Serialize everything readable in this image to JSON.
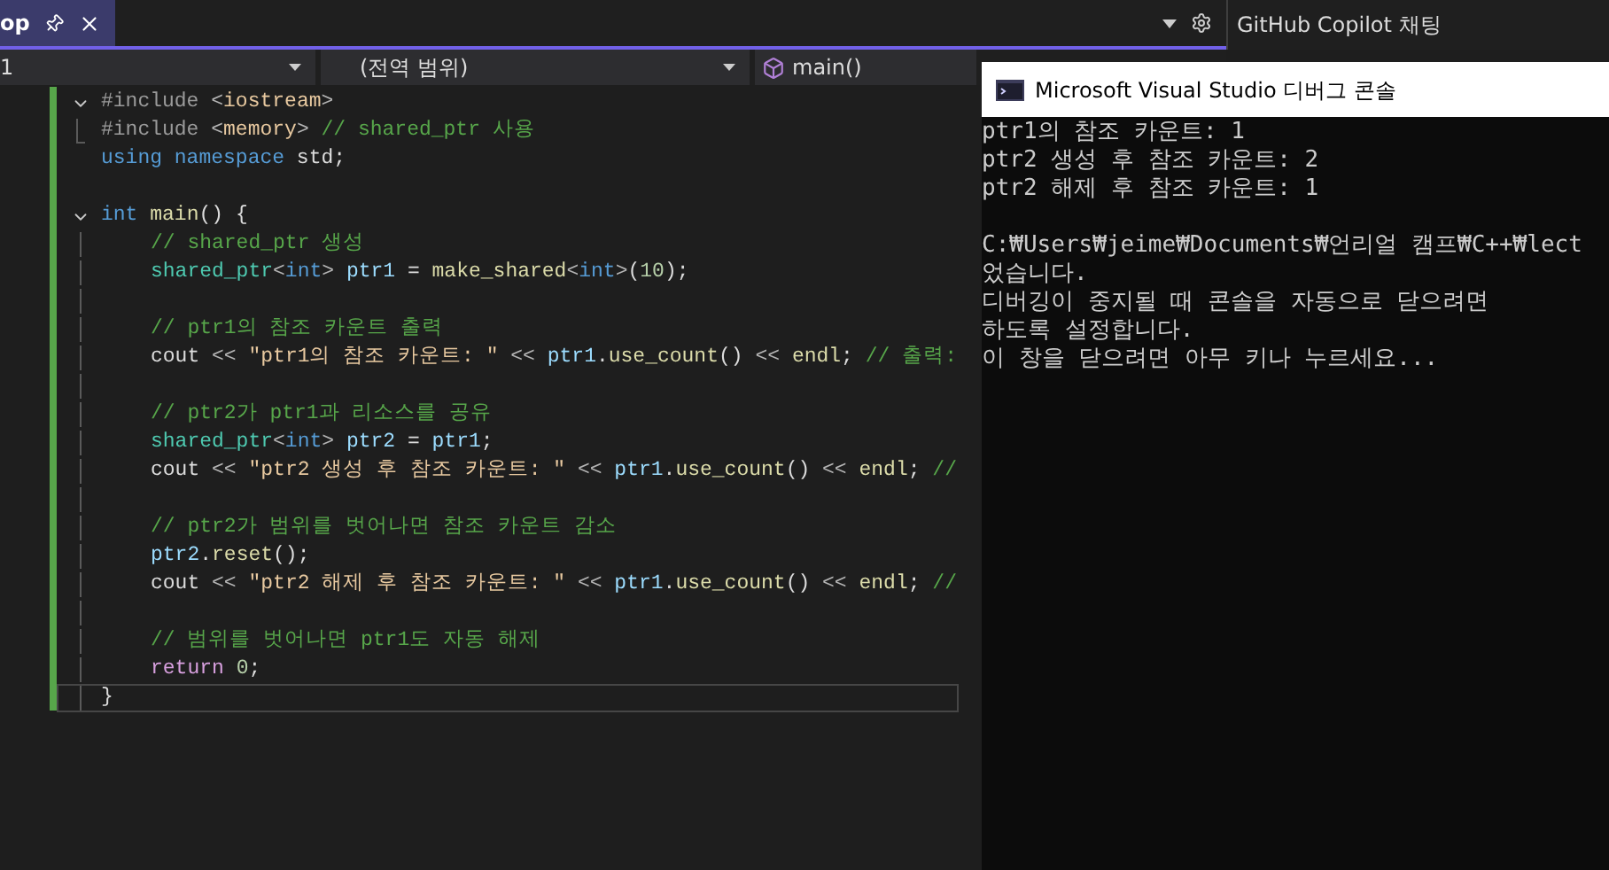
{
  "editor_tab": {
    "label": "op",
    "selected": true
  },
  "nav_bar": {
    "project": "1",
    "scope": "(전역 범위)",
    "member": "main()"
  },
  "copilot_panel": {
    "title": "GitHub Copilot 채팅"
  },
  "code_lines": [
    {
      "kind": "fold_start",
      "segments": [
        {
          "kind": "preproc",
          "text": "#include "
        },
        {
          "kind": "punct",
          "text": "<"
        },
        {
          "kind": "string",
          "text": "iostream"
        },
        {
          "kind": "punct",
          "text": ">"
        }
      ]
    },
    {
      "kind": "fold_end",
      "segments": [
        {
          "kind": "preproc",
          "text": "#include "
        },
        {
          "kind": "punct",
          "text": "<"
        },
        {
          "kind": "string",
          "text": "memory"
        },
        {
          "kind": "punct",
          "text": ">"
        },
        {
          "kind": "comment",
          "text": " // shared_ptr 사용"
        }
      ]
    },
    {
      "kind": "plain",
      "segments": [
        {
          "kind": "keyword",
          "text": "using namespace"
        },
        {
          "kind": "plain",
          "text": " std;"
        }
      ]
    },
    {
      "kind": "plain"
    },
    {
      "kind": "fold_start",
      "segments": [
        {
          "kind": "keyword",
          "text": "int"
        },
        {
          "kind": "func",
          "text": " main"
        },
        {
          "kind": "plain",
          "text": "() {"
        }
      ]
    },
    {
      "kind": "body",
      "segments": [
        {
          "kind": "comment",
          "text": "// shared_ptr 생성"
        }
      ]
    },
    {
      "kind": "body",
      "segments": [
        {
          "kind": "type",
          "text": "shared_ptr"
        },
        {
          "kind": "punct",
          "text": "<"
        },
        {
          "kind": "keyword",
          "text": "int"
        },
        {
          "kind": "punct",
          "text": ">"
        },
        {
          "kind": "var",
          "text": " ptr1"
        },
        {
          "kind": "plain",
          "text": " = "
        },
        {
          "kind": "func",
          "text": "make_shared"
        },
        {
          "kind": "punct",
          "text": "<"
        },
        {
          "kind": "keyword",
          "text": "int"
        },
        {
          "kind": "punct",
          "text": ">"
        },
        {
          "kind": "plain",
          "text": "("
        },
        {
          "kind": "number",
          "text": "10"
        },
        {
          "kind": "plain",
          "text": ");"
        }
      ]
    },
    {
      "kind": "body"
    },
    {
      "kind": "body",
      "segments": [
        {
          "kind": "comment",
          "text": "// ptr1의 참조 카운트 출력"
        }
      ]
    },
    {
      "kind": "body",
      "segments": [
        {
          "kind": "plain",
          "text": "cout "
        },
        {
          "kind": "punct",
          "text": "<< "
        },
        {
          "kind": "string",
          "text": "\"ptr1의 참조 카운트: \""
        },
        {
          "kind": "punct",
          "text": " << "
        },
        {
          "kind": "var",
          "text": "ptr1"
        },
        {
          "kind": "plain",
          "text": "."
        },
        {
          "kind": "func",
          "text": "use_count"
        },
        {
          "kind": "plain",
          "text": "() "
        },
        {
          "kind": "punct",
          "text": "<< "
        },
        {
          "kind": "func",
          "text": "endl"
        },
        {
          "kind": "plain",
          "text": "; "
        },
        {
          "kind": "comment",
          "text": "// 출력:"
        }
      ]
    },
    {
      "kind": "body"
    },
    {
      "kind": "body",
      "segments": [
        {
          "kind": "comment",
          "text": "// ptr2가 ptr1과 리소스를 공유"
        }
      ]
    },
    {
      "kind": "body",
      "segments": [
        {
          "kind": "type",
          "text": "shared_ptr"
        },
        {
          "kind": "punct",
          "text": "<"
        },
        {
          "kind": "keyword",
          "text": "int"
        },
        {
          "kind": "punct",
          "text": ">"
        },
        {
          "kind": "var",
          "text": " ptr2"
        },
        {
          "kind": "plain",
          "text": " = "
        },
        {
          "kind": "var",
          "text": "ptr1"
        },
        {
          "kind": "plain",
          "text": ";"
        }
      ]
    },
    {
      "kind": "body",
      "segments": [
        {
          "kind": "plain",
          "text": "cout "
        },
        {
          "kind": "punct",
          "text": "<< "
        },
        {
          "kind": "string",
          "text": "\"ptr2 생성 후 참조 카운트: \""
        },
        {
          "kind": "punct",
          "text": " << "
        },
        {
          "kind": "var",
          "text": "ptr1"
        },
        {
          "kind": "plain",
          "text": "."
        },
        {
          "kind": "func",
          "text": "use_count"
        },
        {
          "kind": "plain",
          "text": "() "
        },
        {
          "kind": "punct",
          "text": "<< "
        },
        {
          "kind": "func",
          "text": "endl"
        },
        {
          "kind": "plain",
          "text": "; "
        },
        {
          "kind": "comment",
          "text": "//"
        }
      ]
    },
    {
      "kind": "body"
    },
    {
      "kind": "body",
      "segments": [
        {
          "kind": "comment",
          "text": "// ptr2가 범위를 벗어나면 참조 카운트 감소"
        }
      ]
    },
    {
      "kind": "body",
      "segments": [
        {
          "kind": "var",
          "text": "ptr2"
        },
        {
          "kind": "plain",
          "text": "."
        },
        {
          "kind": "func",
          "text": "reset"
        },
        {
          "kind": "plain",
          "text": "();"
        }
      ]
    },
    {
      "kind": "body",
      "segments": [
        {
          "kind": "plain",
          "text": "cout "
        },
        {
          "kind": "punct",
          "text": "<< "
        },
        {
          "kind": "string",
          "text": "\"ptr2 해제 후 참조 카운트: \""
        },
        {
          "kind": "punct",
          "text": " << "
        },
        {
          "kind": "var",
          "text": "ptr1"
        },
        {
          "kind": "plain",
          "text": "."
        },
        {
          "kind": "func",
          "text": "use_count"
        },
        {
          "kind": "plain",
          "text": "() "
        },
        {
          "kind": "punct",
          "text": "<< "
        },
        {
          "kind": "func",
          "text": "endl"
        },
        {
          "kind": "plain",
          "text": "; "
        },
        {
          "kind": "comment",
          "text": "//"
        }
      ]
    },
    {
      "kind": "body"
    },
    {
      "kind": "body",
      "segments": [
        {
          "kind": "comment",
          "text": "// 범위를 벗어나면 ptr1도 자동 해제"
        }
      ]
    },
    {
      "kind": "body",
      "segments": [
        {
          "kind": "control",
          "text": "return"
        },
        {
          "kind": "number",
          "text": " 0"
        },
        {
          "kind": "plain",
          "text": ";"
        }
      ]
    },
    {
      "kind": "current",
      "segments": [
        {
          "kind": "plain",
          "text": "}"
        }
      ]
    }
  ],
  "console": {
    "title": "Microsoft Visual Studio 디버그 콘솔",
    "lines": [
      {
        "text": "ptr1의 참조 카운트: 1"
      },
      {
        "text": "ptr2 생성 후 참조 카운트: 2"
      },
      {
        "text": "ptr2 해제 후 참조 카운트: 1"
      },
      {
        "kind": "blank"
      },
      {
        "text": "C:₩Users₩jeime₩Documents₩언리얼 캠프₩C++₩lect"
      },
      {
        "text": "었습니다."
      },
      {
        "text": "디버깅이 중지될 때 콘솔을 자동으로 닫으려면"
      },
      {
        "text": "하도록 설정합니다."
      },
      {
        "text": "이 창을 닫으려면 아무 키나 누르세요..."
      }
    ]
  }
}
